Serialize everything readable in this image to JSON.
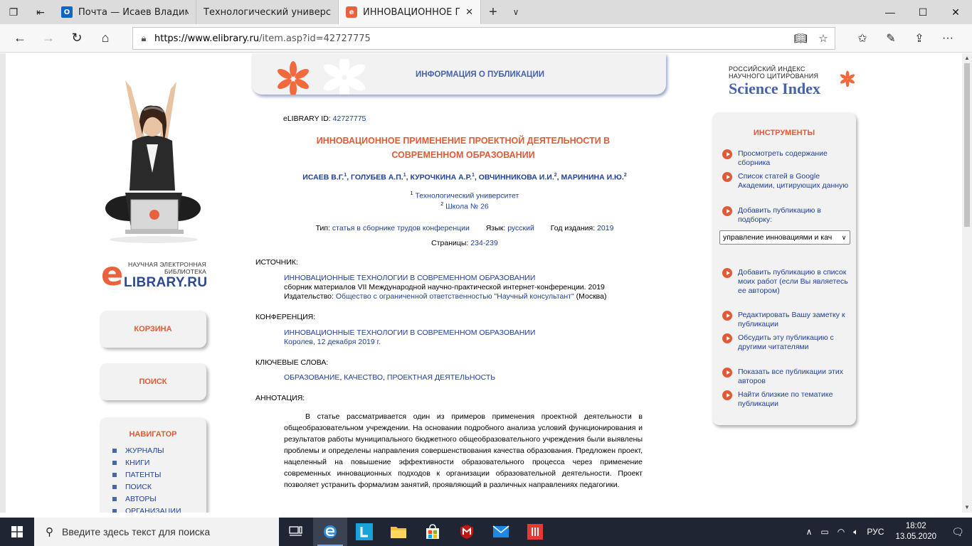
{
  "browser": {
    "tabs": [
      {
        "title": "Почта — Исаев Владимир",
        "active": false
      },
      {
        "title": "Технологический универс",
        "active": false
      },
      {
        "title": "ИННОВАЦИОННОЕ ПР",
        "active": true
      }
    ],
    "url_host": "https://www.elibrary.ru",
    "url_rest": "/item.asp?id=42727775"
  },
  "left": {
    "logo_line1": "НАУЧНАЯ ЭЛЕКТРОННАЯ",
    "logo_line2": "БИБЛИОТЕКА",
    "logo_name": "LIBRARY.RU",
    "basket": "КОРЗИНА",
    "search": "ПОИСК",
    "navigator_title": "НАВИГАТОР",
    "nav_items": [
      "ЖУРНАЛЫ",
      "КНИГИ",
      "ПАТЕНТЫ",
      "ПОИСК",
      "АВТОРЫ",
      "ОРГАНИЗАЦИИ"
    ]
  },
  "pub": {
    "header": "ИНФОРМАЦИЯ О ПУБЛИКАЦИИ",
    "id_label": "eLIBRARY ID:",
    "id_value": "42727775",
    "title_line1": "ИННОВАЦИОННОЕ ПРИМЕНЕНИЕ ПРОЕКТНОЙ ДЕЯТЕЛЬНОСТИ В",
    "title_line2": "СОВРЕМЕННОМ ОБРАЗОВАНИИ",
    "authors": [
      {
        "name": "ИСАЕВ В.Г.",
        "aff": "1"
      },
      {
        "name": "ГОЛУБЕВ А.П.",
        "aff": "1"
      },
      {
        "name": "КУРОЧКИНА А.Р.",
        "aff": "1"
      },
      {
        "name": "ОВЧИННИКОВА И.И.",
        "aff": "2"
      },
      {
        "name": "МАРИНИНА И.Ю.",
        "aff": "2"
      }
    ],
    "affiliations": [
      {
        "num": "1",
        "name": "Технологический университет"
      },
      {
        "num": "2",
        "name": "Школа № 26"
      }
    ],
    "type_label": "Тип:",
    "type_value": "статья в сборнике трудов конференции",
    "lang_label": "Язык:",
    "lang_value": "русский",
    "year_label": "Год издания:",
    "year_value": "2019",
    "pages_label": "Страницы:",
    "pages_value": "234-239",
    "source_label": "ИСТОЧНИК:",
    "source_title": "ИННОВАЦИОННЫЕ ТЕХНОЛОГИИ В СОВРЕМЕННОМ ОБРАЗОВАНИИ",
    "source_sub": "сборник материалов VII Международной научно-практической интернет-конференции. 2019",
    "publisher_label": "Издательство:",
    "publisher_value": "Общество с ограниченной ответственностью \"Научный консультант\"",
    "publisher_city": "(Москва)",
    "conf_label": "КОНФЕРЕНЦИЯ:",
    "conf_title": "ИННОВАЦИОННЫЕ ТЕХНОЛОГИИ В СОВРЕМЕННОМ ОБРАЗОВАНИИ",
    "conf_place": "Королев, 12 декабря 2019 г.",
    "kw_label": "КЛЮЧЕВЫЕ СЛОВА:",
    "keywords": [
      "ОБРАЗОВАНИЕ",
      "КАЧЕСТВО",
      "ПРОЕКТНАЯ ДЕЯТЕЛЬНОСТЬ"
    ],
    "abstract_label": "АННОТАЦИЯ:",
    "abstract": "В статье рассматривается один из примеров применения проектной деятельности в общеобразовательном учреждении. На основании подробного анализа условий функционирования и результатов работы муниципального бюджетного общеобразовательного учреждения были выявлены проблемы и определены направления совершенствования качества образования. Предложен проект, нацеленный на повышение эффективности образовательного процесса через применение современных инновационных подходов к организации образовательной деятельности. Проект позволяет устранить формализм занятий, проявляющий в различных направлениях педагогики."
  },
  "right": {
    "sci_line1": "РОССИЙСКИЙ ИНДЕКС",
    "sci_line2": "НАУЧНОГО ЦИТИРОВАНИЯ",
    "sci_name": "Science Index",
    "tools_title": "ИНСТРУМЕНТЫ",
    "tools": [
      "Просмотреть содержание сборника",
      "Список статей в Google Академии, цитирующих данную",
      "Добавить публикацию в подборку:",
      "Добавить публикацию в список моих работ (если Вы являетесь ее автором)",
      "Редактировать Вашу заметку к публикации",
      "Обсудить эту публикацию с другими читателями",
      "Показать все публикации этих авторов",
      "Найти близкие по тематике публикации"
    ],
    "select_value": "управление инновациями и кач"
  },
  "taskbar": {
    "search_placeholder": "Введите здесь текст для поиска",
    "lang": "РУС",
    "time": "18:02",
    "date": "13.05.2020"
  },
  "colors": {
    "accent": "#e05a36",
    "link": "#1f3f99",
    "brand_blue": "#4463a8"
  }
}
